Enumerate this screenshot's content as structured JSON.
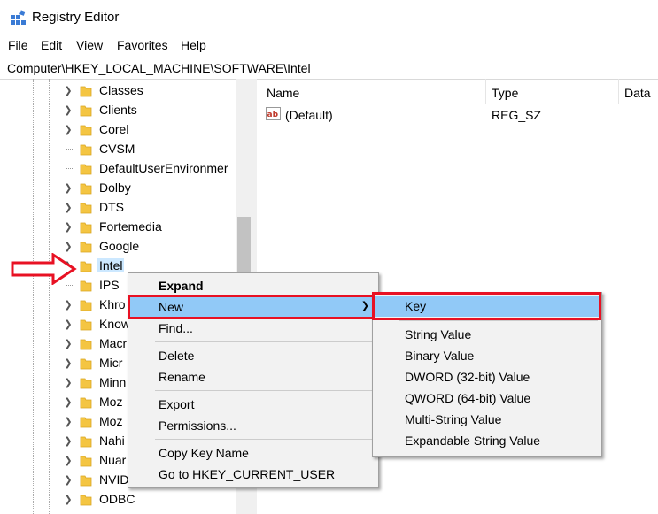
{
  "window": {
    "title": "Registry Editor"
  },
  "menubar": [
    "File",
    "Edit",
    "View",
    "Favorites",
    "Help"
  ],
  "address": "Computer\\HKEY_LOCAL_MACHINE\\SOFTWARE\\Intel",
  "tree": {
    "items": [
      {
        "label": "Classes",
        "expander": "chevron"
      },
      {
        "label": "Clients",
        "expander": "chevron"
      },
      {
        "label": "Corel",
        "expander": "chevron"
      },
      {
        "label": "CVSM",
        "expander": "none"
      },
      {
        "label": "DefaultUserEnvironmer",
        "expander": "none"
      },
      {
        "label": "Dolby",
        "expander": "chevron"
      },
      {
        "label": "DTS",
        "expander": "chevron"
      },
      {
        "label": "Fortemedia",
        "expander": "chevron"
      },
      {
        "label": "Google",
        "expander": "chevron"
      },
      {
        "label": "Intel",
        "expander": "chevron",
        "selected": true
      },
      {
        "label": "IPS",
        "expander": "none"
      },
      {
        "label": "Khro",
        "expander": "chevron"
      },
      {
        "label": "Know",
        "expander": "chevron"
      },
      {
        "label": "Macr",
        "expander": "chevron"
      },
      {
        "label": "Micr",
        "expander": "chevron"
      },
      {
        "label": "Minn",
        "expander": "chevron"
      },
      {
        "label": "Moz",
        "expander": "chevron"
      },
      {
        "label": "Moz",
        "expander": "chevron"
      },
      {
        "label": "Nahi",
        "expander": "chevron"
      },
      {
        "label": "Nuar",
        "expander": "chevron"
      },
      {
        "label": "NVID",
        "expander": "chevron"
      },
      {
        "label": "ODBC",
        "expander": "chevron"
      }
    ]
  },
  "list": {
    "columns": [
      "Name",
      "Type",
      "Data"
    ],
    "rows": [
      {
        "name": "(Default)",
        "type": "REG_SZ",
        "icon": "string-value-icon"
      }
    ]
  },
  "context_menu": {
    "expand": "Expand",
    "new": "New",
    "find": "Find...",
    "delete": "Delete",
    "rename": "Rename",
    "export": "Export",
    "permissions": "Permissions...",
    "copy_key_name": "Copy Key Name",
    "goto_hkcu": "Go to HKEY_CURRENT_USER"
  },
  "submenu": {
    "key": "Key",
    "string_value": "String Value",
    "binary_value": "Binary Value",
    "dword_value": "DWORD (32-bit) Value",
    "qword_value": "QWORD (64-bit) Value",
    "multi_string_value": "Multi-String Value",
    "expandable_string_value": "Expandable String Value"
  },
  "colors": {
    "highlight": "#91c9f7",
    "annotation": "#e81123",
    "folder": "#f4c542",
    "selection": "#cce8ff"
  }
}
